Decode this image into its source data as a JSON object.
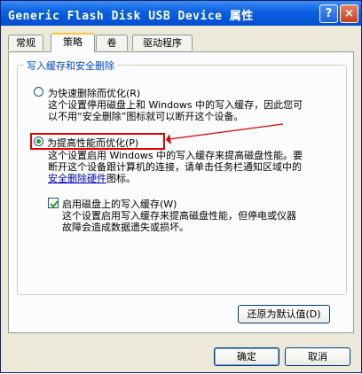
{
  "window": {
    "title": "Generic Flash Disk USB Device 属性",
    "help_btn": "?",
    "close_btn": "×"
  },
  "tabs": [
    {
      "label": "常规",
      "active": false
    },
    {
      "label": "策略",
      "active": true
    },
    {
      "label": "卷",
      "active": false
    },
    {
      "label": "驱动程序",
      "active": false
    }
  ],
  "group": {
    "title": "写入缓存和安全删除"
  },
  "option_quick": {
    "label": "为快速删除而优化(R)",
    "desc": [
      "这个设置停用磁盘上和 Windows 中的写入缓存，因此您可",
      "以不用“安全删除”图标就可以断开这个设备。"
    ],
    "selected": false
  },
  "option_perf": {
    "label": "为提高性能而优化(P)",
    "desc": [
      "这个设置启用 Windows 中的写入缓存来提高磁盘性能。要",
      "断开这个设备跟计算机的连接，请单击任务栏通知区域中的"
    ],
    "link": "安全删除硬件",
    "link_suffix": "图标。",
    "selected": true
  },
  "checkbox_cache": {
    "label": "启用磁盘上的写入缓存(W)",
    "desc": [
      "这个设置启用写入缓存来提高磁盘性能，但停电或仪器",
      "故障会造成数据遗失或损坏。"
    ],
    "checked": true
  },
  "buttons": {
    "restore": "还原为默认值(D)",
    "ok": "确定",
    "cancel": "取消"
  },
  "colors": {
    "titlebar": "#0a5fe0",
    "highlight_box": "#e00000",
    "group_title": "#0046d5"
  }
}
